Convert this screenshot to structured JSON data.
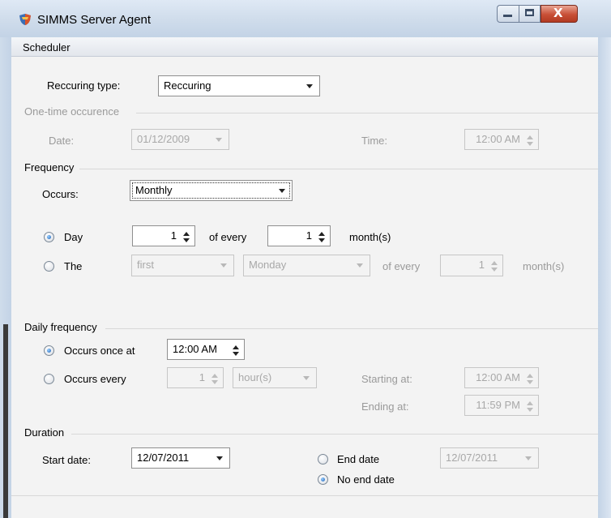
{
  "window": {
    "title": "SIMMS Server Agent",
    "close_glyph": "X"
  },
  "menu": {
    "scheduler": "Scheduler"
  },
  "recurring": {
    "label": "Reccuring type:",
    "value": "Reccuring"
  },
  "one_time": {
    "section": "One-time occurence",
    "date_label": "Date:",
    "date_value": "01/12/2009",
    "time_label": "Time:",
    "time_value": "12:00 AM"
  },
  "frequency": {
    "section": "Frequency",
    "occurs_label": "Occurs:",
    "occurs_value": "Monthly",
    "day_option": "Day",
    "day_value": "1",
    "of_every": "of every",
    "every_value": "1",
    "months": "month(s)",
    "the_option": "The",
    "ordinal_value": "first",
    "weekday_value": "Monday",
    "of_every_2": "of every",
    "every_value_2": "1",
    "months_2": "month(s)",
    "selected": "Day"
  },
  "daily": {
    "section": "Daily frequency",
    "once_option": "Occurs once at",
    "once_value": "12:00 AM",
    "every_option": "Occurs every",
    "every_value": "1",
    "unit_value": "hour(s)",
    "starting_label": "Starting at:",
    "starting_value": "12:00 AM",
    "ending_label": "Ending at:",
    "ending_value": "11:59 PM",
    "selected": "Occurs once at"
  },
  "duration": {
    "section": "Duration",
    "start_label": "Start date:",
    "start_value": "12/07/2011",
    "end_option": "End date",
    "end_value": "12/07/2011",
    "no_end_option": "No end date",
    "selected": "No end date"
  },
  "colors": {
    "title_bar": "#cfdceb",
    "close_button": "#c84f36",
    "radio_selected": "#1b5fb4"
  },
  "icons": {
    "app": "shield-icon"
  }
}
